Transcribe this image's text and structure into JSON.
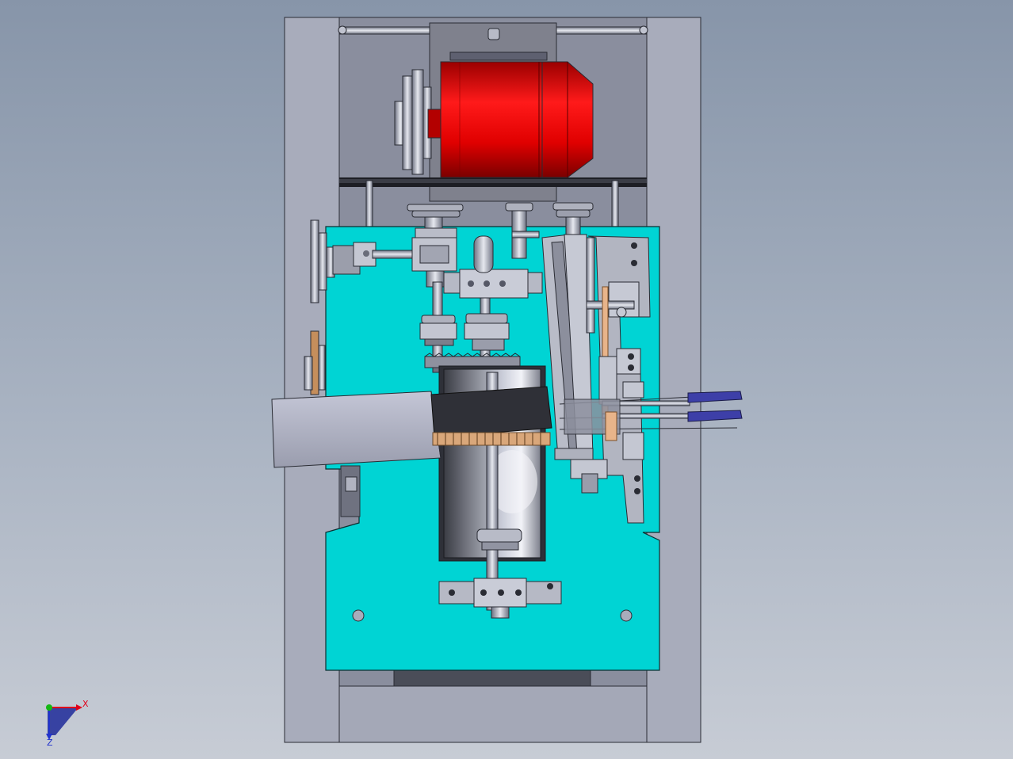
{
  "viewport": {
    "background_top": "#8795a9",
    "background_bottom": "#c7ccd5"
  },
  "model": {
    "frame_color": "#a8acbb",
    "plate_color": "#00d4d4",
    "motor_color": "#e60000",
    "part_color": "#b4b7c4",
    "handle_color": "#3d3fa8",
    "copper_color": "#e8b48a"
  },
  "triad": {
    "x_label": "X",
    "z_label": "Z",
    "x_color": "#e0001a",
    "y_color": "#14b814",
    "z_color": "#2233cc"
  }
}
